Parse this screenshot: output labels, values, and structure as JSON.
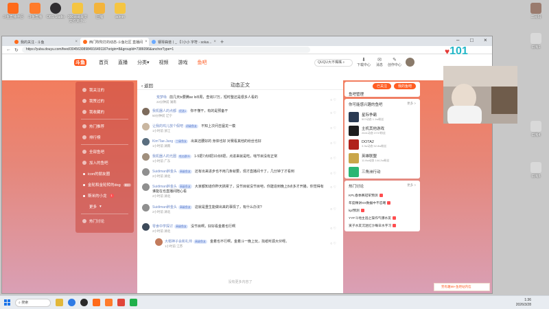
{
  "desktop": {
    "icons_top": [
      "斗鱼直播伴侣",
      "斗鱼直播",
      "OBS Studio",
      "000哥哥最爱文件夹小...",
      "压缩",
      "admin"
    ],
    "icons_right": [
      "二哥妈",
      "口哨1",
      "口哨4",
      "口哨5"
    ]
  },
  "browser": {
    "tabs": [
      {
        "label": "我的关注 - 斗鱼"
      },
      {
        "label": "西门吹吹打的动态-斗鱼社区 直播间"
      },
      {
        "label": "钢琴曲谱丨_ 【（小小 字符 - solus..."
      }
    ],
    "new_tab": "+",
    "url": "https://yuba.douyu.com/feed/3045630898491649116?origin=8&groupId=7386096&anchorType=1"
  },
  "site": {
    "logo_badge": "斗鱼",
    "nav": [
      "首页",
      "直播",
      "分类",
      "视频",
      "游戏",
      "鱼吧"
    ],
    "search_placeholder": "QUQU大不嘴嘴",
    "header_icons": [
      "下载中心",
      "消息",
      "创作中心"
    ]
  },
  "sidebar": {
    "items": [
      {
        "label": "我关注的"
      },
      {
        "label": "我赞过的"
      },
      {
        "label": "我收藏的"
      },
      {
        "label": "热门推荐"
      },
      {
        "label": "排行榜"
      },
      {
        "label": "全部鱼吧"
      },
      {
        "label": "加入的鱼吧"
      },
      {
        "label": "icon的朋友圈"
      },
      {
        "label": "金轮和金轮转的dog",
        "count": "99+"
      },
      {
        "label": "斯米的小龙",
        "count": "1"
      },
      {
        "label": "更多"
      },
      {
        "label": "热门讨论"
      }
    ]
  },
  "main": {
    "back_label": "返回",
    "title": "动态正文",
    "comments": [
      {
        "name": "荒梦咏",
        "text": "前几天tx要腾ax lol5周，查询17万，短时整还是很多人看的",
        "meta": "22分钟前 湖南"
      },
      {
        "name": "我机器人的点都",
        "level": "",
        "text": "你不懂干，有的是预备干",
        "meta": "50分钟前 辽宁"
      },
      {
        "name": "让我的鸡儿放个假吧",
        "text": "不知上次问击猛龙一模",
        "meta": "1小时前 浙江"
      },
      {
        "name": "Kim'Tae-Jang",
        "text": "出来还腰好的 身体也好 对赛看其他的纷丝也好",
        "meta": "1小时前 湖南"
      },
      {
        "name": "我机器人的光圈",
        "text": "1-5把7点8把10点8把，点进来就是吃。啥节目没有正常",
        "meta": "1小时前 广东"
      },
      {
        "name": "Suidiman醉金头",
        "text": "还有出来进步也不用几条就要，现才直播间卡了，几分钟了才看到",
        "meta": "2小时前 湖北"
      },
      {
        "name": "Suidiman醉金头",
        "text": "大家都知道你昨天搞累了，没节目就没节目吧，你建造到晚上8点多才开播，你觉得有谁能在也直播间陪心看",
        "meta": "2小时前 湖北"
      },
      {
        "name": "Suidiman醉金头",
        "text": "这就是重生能做出来的事情了，有什么办法?",
        "meta": "2小时前 湖北"
      },
      {
        "name": "零食中学探讨",
        "text": "没节目啊，好好看金着也行啊",
        "meta": "2小时前 湖北"
      },
      {
        "name": "大帽神子会和礼帅",
        "text": "金着也不行啊，金着斗一晚上玩，找纸听源大伙呀。",
        "meta": "1小时前 江苏"
      }
    ],
    "level_badges": [
      "吃瓜群众",
      "优选1",
      "初级鱼友",
      "三级鱼友",
      "吃瓜群众",
      "高级鱼友",
      "高级鱼友",
      "高级鱼友",
      "高级鱼友",
      "高级鱼友"
    ],
    "end_text": "没有更多内容了"
  },
  "right": {
    "manage_title": "鱼吧管理",
    "manage_buttons": [
      "已关注",
      "我的鱼吧"
    ],
    "followed_title": "你可能感兴趣的鱼吧",
    "followed_more": "更多 >",
    "bars": [
      {
        "name": "星际争霸",
        "stats": "507动态  1.1w粉丝"
      },
      {
        "name": "主机其他游戏",
        "stats": "2641动态  3737粉丝"
      },
      {
        "name": "DOTA2",
        "stats": "3.3w动态  52.8w粉丝"
      },
      {
        "name": "英雄联盟",
        "stats": "11.6w动态  144.2w粉丝"
      },
      {
        "name": "三角洲行动",
        "stats": ""
      }
    ],
    "hot_title": "热门讨论",
    "hot_more": "更多 >",
    "hot_items": [
      "KPL春季赛冠军预测",
      "年度精讲XX数据中不忍睹",
      "kpl预测",
      "YYF斗地主逃之操作气爆水友",
      "寅子水友沉迷红沙每日水字习"
    ]
  },
  "float_button": "劳有趣99+鱼吧站内信",
  "overlay": {
    "brand_number": "101"
  },
  "taskbar": {
    "search": "搜索",
    "time": "1:36",
    "date": "2026/3/28"
  }
}
